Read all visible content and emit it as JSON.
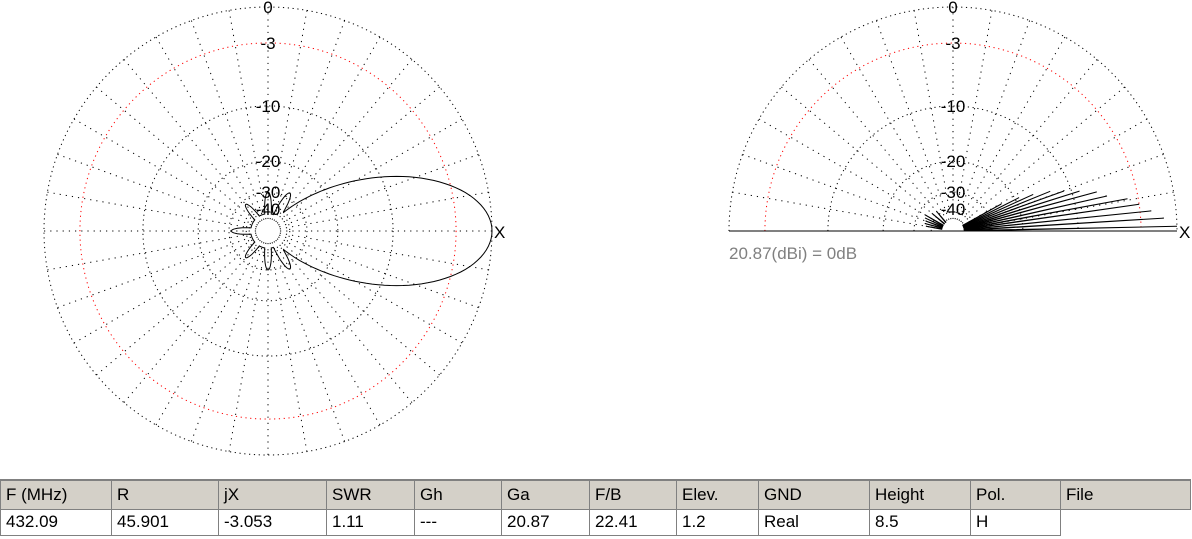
{
  "chart_data": [
    {
      "type": "polar",
      "view": "azimuth",
      "ring_labels": [
        "0",
        "-3",
        "-10",
        "-20",
        "-30",
        "-40"
      ],
      "ring_db": [
        0,
        -3,
        -10,
        -20,
        -30,
        -40
      ],
      "x_marker": "X",
      "main_lobe": {
        "direction_deg": 0,
        "gain_db": 0,
        "half_width_deg": 28
      },
      "side_lobes_db": [
        {
          "angle_deg": 35,
          "gain_db": -22
        },
        {
          "angle_deg": -35,
          "gain_db": -22
        },
        {
          "angle_deg": 60,
          "gain_db": -28
        },
        {
          "angle_deg": -60,
          "gain_db": -28
        },
        {
          "angle_deg": 90,
          "gain_db": -30
        },
        {
          "angle_deg": -90,
          "gain_db": -30
        },
        {
          "angle_deg": 130,
          "gain_db": -32
        },
        {
          "angle_deg": -130,
          "gain_db": -32
        },
        {
          "angle_deg": 180,
          "gain_db": -31
        }
      ]
    },
    {
      "type": "polar",
      "view": "elevation",
      "ring_labels": [
        "0",
        "-3",
        "-10",
        "-20",
        "-30",
        "-40"
      ],
      "ring_db": [
        0,
        -3,
        -10,
        -20,
        -30,
        -40
      ],
      "x_marker": "X",
      "reference_text": "20.87(dBi) = 0dB",
      "main_lobe": {
        "elevation_deg": 1.2,
        "gain_db": 0
      },
      "forward_lobes": [
        {
          "elevation_deg": 1.2,
          "gain_db": 0
        },
        {
          "elevation_deg": 3.5,
          "gain_db": -1
        },
        {
          "elevation_deg": 5.8,
          "gain_db": -2
        },
        {
          "elevation_deg": 8.2,
          "gain_db": -3
        },
        {
          "elevation_deg": 10.5,
          "gain_db": -4
        },
        {
          "elevation_deg": 12.8,
          "gain_db": -6
        },
        {
          "elevation_deg": 15.2,
          "gain_db": -7
        },
        {
          "elevation_deg": 17.5,
          "gain_db": -9
        },
        {
          "elevation_deg": 19.8,
          "gain_db": -11
        },
        {
          "elevation_deg": 22.2,
          "gain_db": -13
        },
        {
          "elevation_deg": 24.5,
          "gain_db": -16
        },
        {
          "elevation_deg": 26.8,
          "gain_db": -19
        },
        {
          "elevation_deg": 29.2,
          "gain_db": -24
        }
      ],
      "back_lobes": [
        {
          "elevation_deg": 150,
          "gain_db": -33
        },
        {
          "elevation_deg": 155,
          "gain_db": -34
        },
        {
          "elevation_deg": 160,
          "gain_db": -35
        },
        {
          "elevation_deg": 165,
          "gain_db": -35
        },
        {
          "elevation_deg": 170,
          "gain_db": -36
        },
        {
          "elevation_deg": 130,
          "gain_db": -37
        },
        {
          "elevation_deg": 140,
          "gain_db": -36
        }
      ]
    }
  ],
  "results_table": {
    "headers": [
      "F (MHz)",
      "R",
      "jX",
      "SWR",
      "Gh",
      "Ga",
      "F/B",
      "Elev.",
      "GND",
      "Height",
      "Pol.",
      "File"
    ],
    "row": [
      "432.09",
      "45.901",
      "-3.053",
      "1.11",
      "---",
      "20.87",
      "22.41",
      "1.2",
      "Real",
      "8.5",
      "H",
      ""
    ]
  }
}
